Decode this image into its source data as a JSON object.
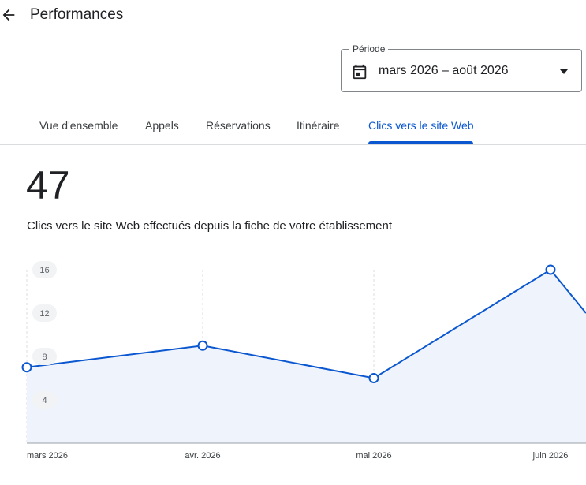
{
  "header": {
    "title": "Performances",
    "back_icon": "arrow-back-icon"
  },
  "period": {
    "label": "Période",
    "value": "mars 2026 – août 2026",
    "icon": "calendar-icon",
    "dropdown_icon": "arrow-drop-down-icon"
  },
  "tabs": [
    {
      "label": "Vue d'ensemble",
      "active": false
    },
    {
      "label": "Appels",
      "active": false
    },
    {
      "label": "Réservations",
      "active": false
    },
    {
      "label": "Itinéraire",
      "active": false
    },
    {
      "label": "Clics vers le site Web",
      "active": true
    }
  ],
  "summary": {
    "total": "47",
    "description": "Clics vers le site Web effectués depuis la fiche de votre établissement"
  },
  "colors": {
    "accent": "#0b57d0",
    "area_fill": "#eff4fc",
    "grid": "#dadce0"
  },
  "chart_data": {
    "type": "area",
    "title": "",
    "xlabel": "",
    "ylabel": "",
    "x": [
      "mars 2026",
      "avr. 2026",
      "mai 2026",
      "juin 2026"
    ],
    "series": [
      {
        "values": [
          7,
          9,
          6,
          16
        ]
      }
    ],
    "y_ticks": [
      "16",
      "12",
      "8",
      "4"
    ],
    "ylim": [
      0,
      16
    ],
    "grid": "vertical dashed",
    "legend": "none"
  }
}
